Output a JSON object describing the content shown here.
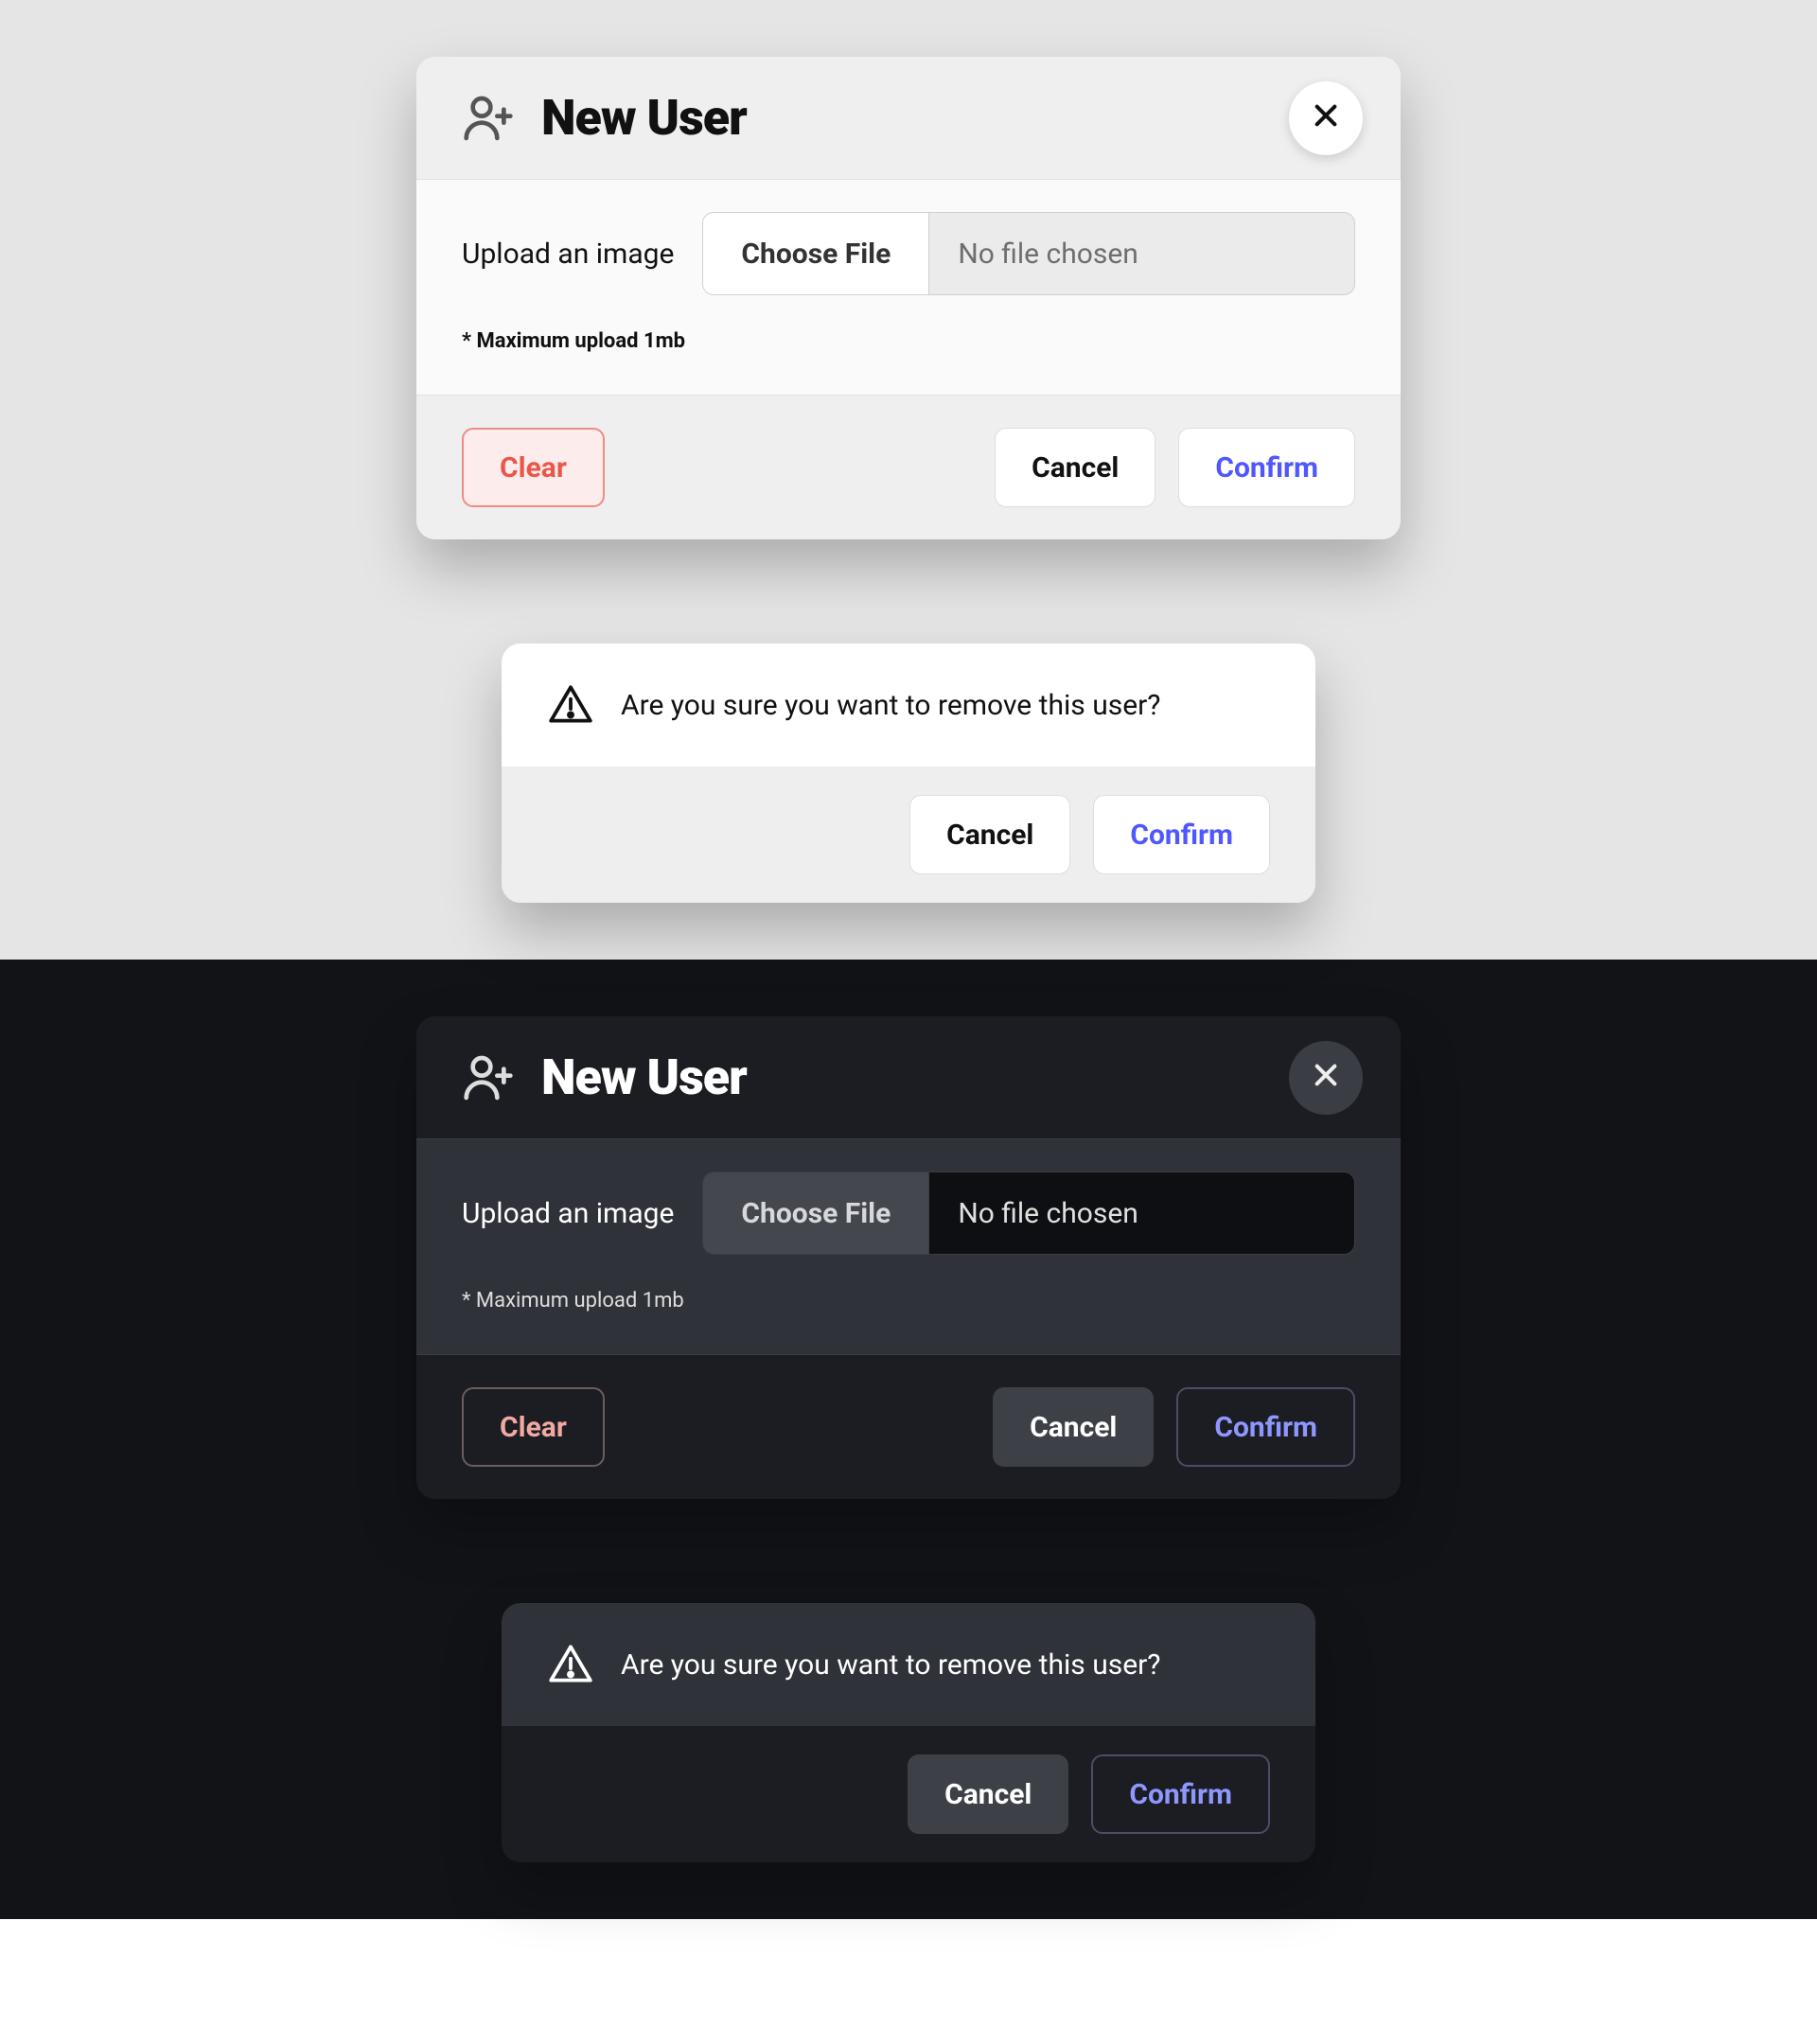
{
  "new_user_card": {
    "title": "New User",
    "upload_label": "Upload an image",
    "choose_file_label": "Choose File",
    "file_status": "No file chosen",
    "hint": "* Maximum upload 1mb",
    "clear_label": "Clear",
    "cancel_label": "Cancel",
    "confirm_label": "Confirm"
  },
  "remove_user_alert": {
    "message": "Are you sure you want to remove this user?",
    "cancel_label": "Cancel",
    "confirm_label": "Confirm"
  },
  "colors": {
    "accent_confirm": "#4f57ff",
    "accent_danger": "#e9574b",
    "dark_bg": "#121317",
    "light_bg": "#e5e5e5"
  }
}
